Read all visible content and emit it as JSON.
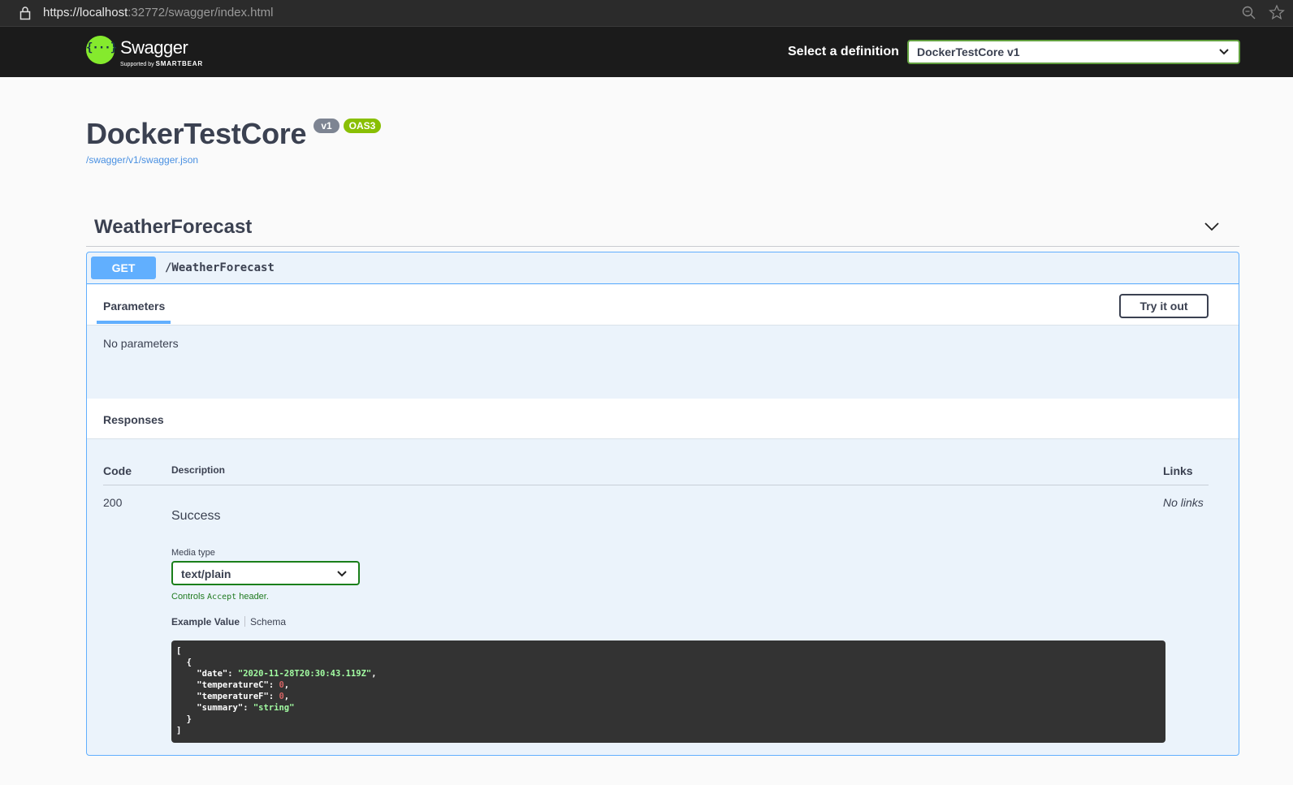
{
  "browser": {
    "url_scheme": "https://",
    "url_host": "localhost",
    "url_rest": ":32772/swagger/index.html"
  },
  "topbar": {
    "logo_name": "Swagger",
    "logo_symbol": "{···}",
    "logo_supported_by": "Supported by",
    "logo_smartbear": "SMARTBEAR",
    "definition_label": "Select a definition",
    "definition_value": "DockerTestCore v1"
  },
  "info": {
    "title": "DockerTestCore",
    "version_badge": "v1",
    "oas_badge": "OAS3",
    "spec_url": "/swagger/v1/swagger.json"
  },
  "tag": {
    "name": "WeatherForecast"
  },
  "operation": {
    "method": "GET",
    "path": "/WeatherForecast",
    "parameters_tab": "Parameters",
    "try_it_out": "Try it out",
    "no_parameters": "No parameters",
    "responses_title": "Responses",
    "columns": {
      "code": "Code",
      "description": "Description",
      "links": "Links"
    },
    "response": {
      "code": "200",
      "description": "Success",
      "links": "No links",
      "media_type_label": "Media type",
      "media_type_value": "text/plain",
      "controls_prefix": "Controls ",
      "controls_code": "Accept",
      "controls_suffix": " header.",
      "example_value_tab": "Example Value",
      "schema_tab": "Schema",
      "example": {
        "date": "\"2020-11-28T20:30:43.119Z\"",
        "temperatureC": "0",
        "temperatureF": "0",
        "summary": "\"string\""
      }
    }
  },
  "colors": {
    "get_accent": "#61affe",
    "get_bg": "#ebf3fb",
    "oas_badge": "#89bf04",
    "version_badge": "#7d8492",
    "swagger_green": "#85ea2d",
    "topbar_bg": "#1b1b1b"
  }
}
